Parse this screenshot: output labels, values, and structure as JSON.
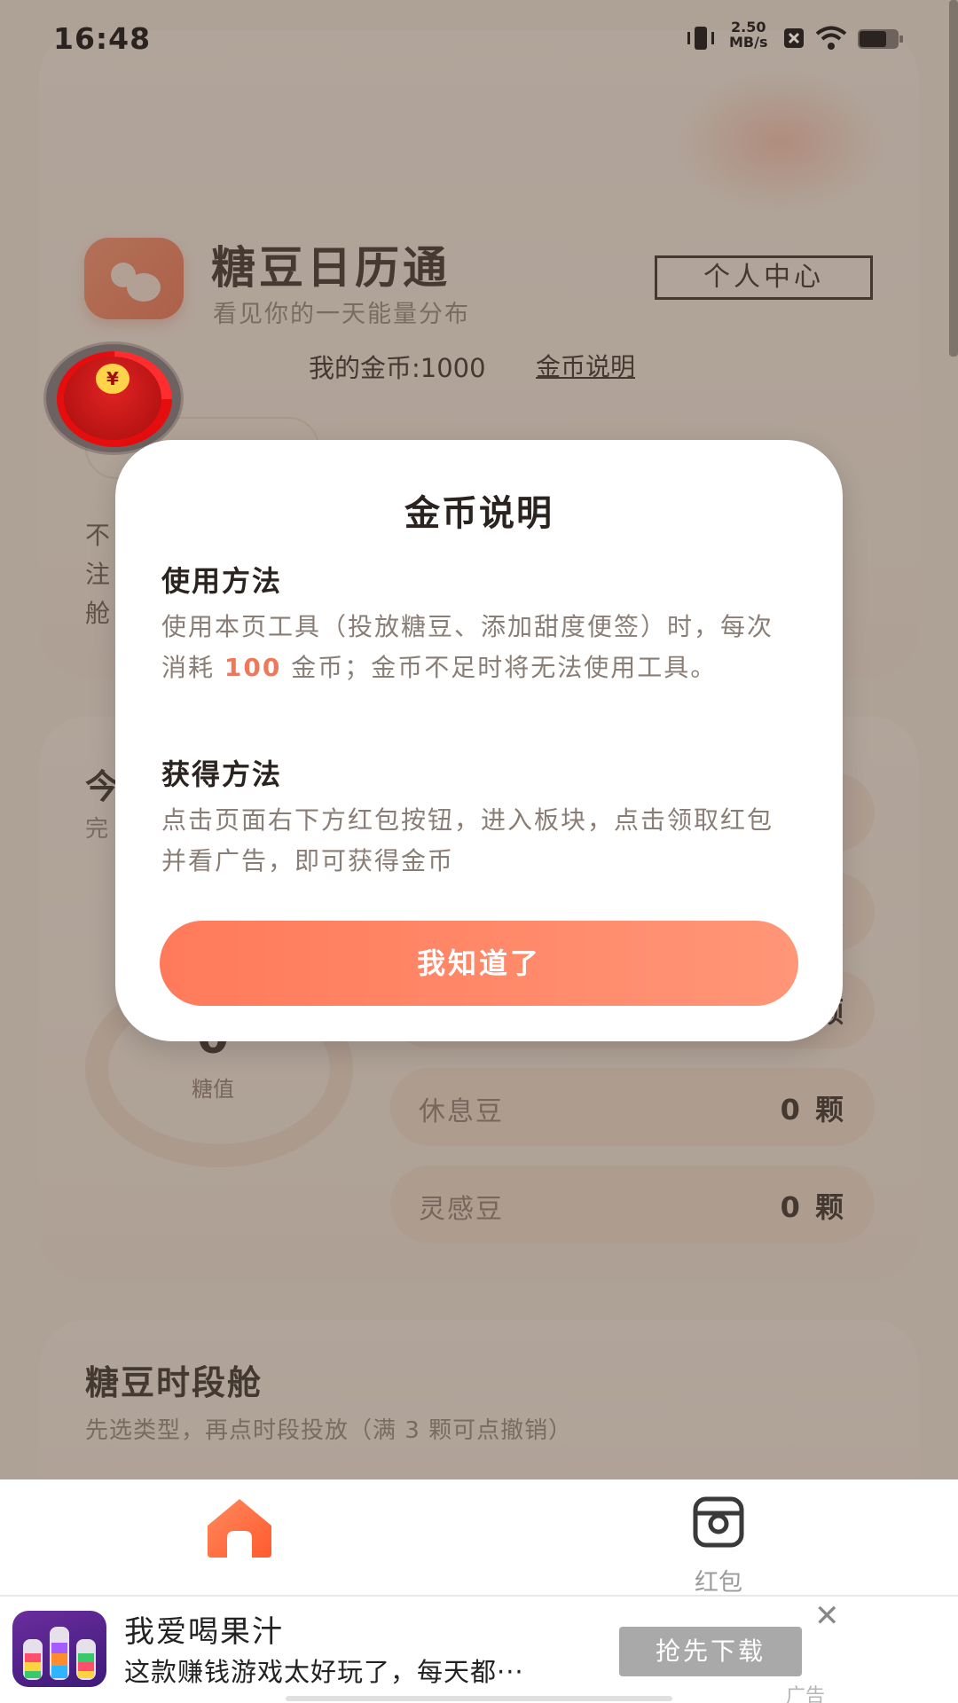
{
  "status_bar": {
    "time": "16:48",
    "network_speed_top": "2.50",
    "network_speed_unit": "MB/s",
    "icons": [
      "vibrate-icon",
      "network-speed",
      "sim-icon",
      "wifi-icon",
      "battery-icon"
    ]
  },
  "header": {
    "app_title": "糖豆日历通",
    "app_subtitle": "看见你的一天能量分布",
    "profile_button": "个人中心",
    "coins_text": "我的金币:1000",
    "coin_info_link": "金币说明"
  },
  "background_partial": {
    "line1": "不",
    "line2": "注",
    "line3": "舱",
    "today_prefix": "今",
    "today_sub_prefix": "完"
  },
  "beans": [
    {
      "name": "休息豆",
      "count": "0 颗"
    },
    {
      "name": "灵感豆",
      "count": "0 颗"
    }
  ],
  "partial_bean_counts": [
    "颗",
    "颗"
  ],
  "sugar": {
    "value": "0",
    "label": "糖值"
  },
  "section": {
    "title": "糖豆时段舱",
    "subtitle": "先选类型，再点时段投放（满 3 颗可点撤销）"
  },
  "modal": {
    "title": "金币说明",
    "usage_heading": "使用方法",
    "usage_text_before": "使用本页工具（投放糖豆、添加甜度便签）时，每次消耗",
    "usage_highlight": "100",
    "usage_text_after": "金币；金币不足时将无法使用工具。",
    "earn_heading": "获得方法",
    "earn_text": "点击页面右下方红包按钮，进入板块，点击领取红包并看广告，即可获得金币",
    "confirm_button": "我知道了"
  },
  "red_packet_symbol": "¥",
  "nav": {
    "home_icon": "home-icon",
    "hongbao_label": "红包"
  },
  "ad": {
    "title": "我爱喝果汁",
    "description": "这款赚钱游戏太好玩了，每天都···",
    "button": "抢先下载",
    "close": "✕",
    "tag": "广告"
  },
  "colors": {
    "accent": "#ff7a5a",
    "highlight": "#f0785a",
    "overlay": "rgba(96,82,70,0.48)"
  }
}
